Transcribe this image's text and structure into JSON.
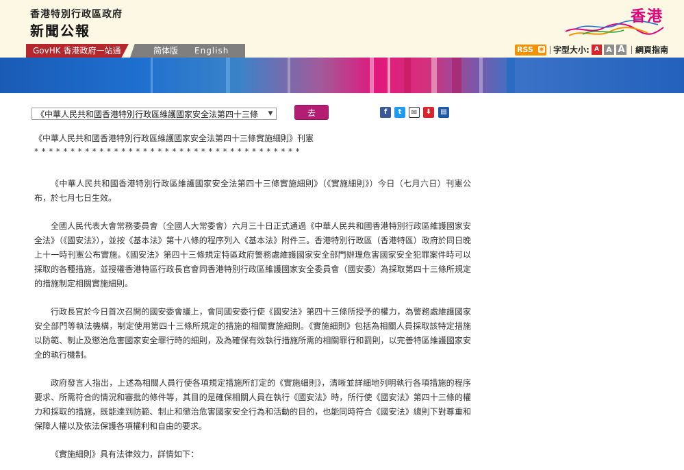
{
  "header": {
    "department": "香港特別行政區政府",
    "site_title": "新聞公報",
    "brand_text": "香港"
  },
  "nav": {
    "govhk": "GovHK 香港政府一站通",
    "simplified": "简体版",
    "english": "English",
    "rss": "RSS",
    "font_size_label": "字型大小:",
    "font_buttons": [
      "A",
      "A",
      "A"
    ],
    "web_guide": "網頁指南"
  },
  "toolbar": {
    "select_value": "《中華人民共和國香港特別行政區維護國家安全法第四十三條",
    "go_label": "去",
    "share_icons": [
      "facebook-icon",
      "twitter-icon",
      "email-icon",
      "download-icon",
      "print-icon"
    ]
  },
  "article": {
    "headline": "《中華人民共和國香港特別行政區維護國家安全法第四十三條實施細則》刊憲",
    "stars": "*************************************",
    "paragraphs": [
      "《中華人民共和國香港特別行政區維護國家安全法第四十三條實施細則》（《實施細則》）今日（七月六日）刊憲公布，於七月七日生效。",
      "全國人民代表大會常務委員會（全國人大常委會）六月三十日正式通過《中華人民共和國香港特別行政區維護國家安全法》（《國安法》），並按《基本法》第十八條的程序列入《基本法》附件三。香港特別行政區（香港特區）政府於同日晚上十一時刊憲公布實施。《國安法》第四十三條規定特區政府警務處維護國家安全部門辦理危害國家安全犯罪案件時可以採取的各種措施，並授權香港特區行政長官會同香港特別行政區維護國家安全委員會（國安委）為採取第四十三條所規定的措施制定相關實施細則。",
      "行政長官於今日首次召開的國安委會議上，會同國安委行使《國安法》第四十三條所授予的權力，為警務處維護國家安全部門等執法機構，制定使用第四十三條所規定的措施的相關實施細則。《實施細則》包括為相關人員採取該特定措施以防範、制止及懲治危害國家安全罪行時的細則，及為確保有效執行措施所需的相關罪行和罰則，以完善特區維護國家安全的執行機制。",
      "政府發言人指出，上述為相關人員行使各項規定措施所訂定的《實施細則》，清晰並詳細地列明執行各項措施的程序要求、所需符合的情況和審批的條件等，其目的是確保相關人員在執行《國安法》時，所行使《國安法》第四十三條的權力和採取的措施，既能達到防範、制止和懲治危害國家安全行為和活動的目的，也能同時符合《國安法》總則下對尊重和保障人權以及依法保護各項權利和自由的要求。",
      "《實施細則》具有法律效力，詳情如下："
    ]
  },
  "colors": {
    "govhk_red": "#b3272d",
    "go_button": "#b31d74",
    "rss_orange": "#f39200",
    "font_btn_red": "#d9232d",
    "font_btn_gray": "#8c8c8c"
  }
}
